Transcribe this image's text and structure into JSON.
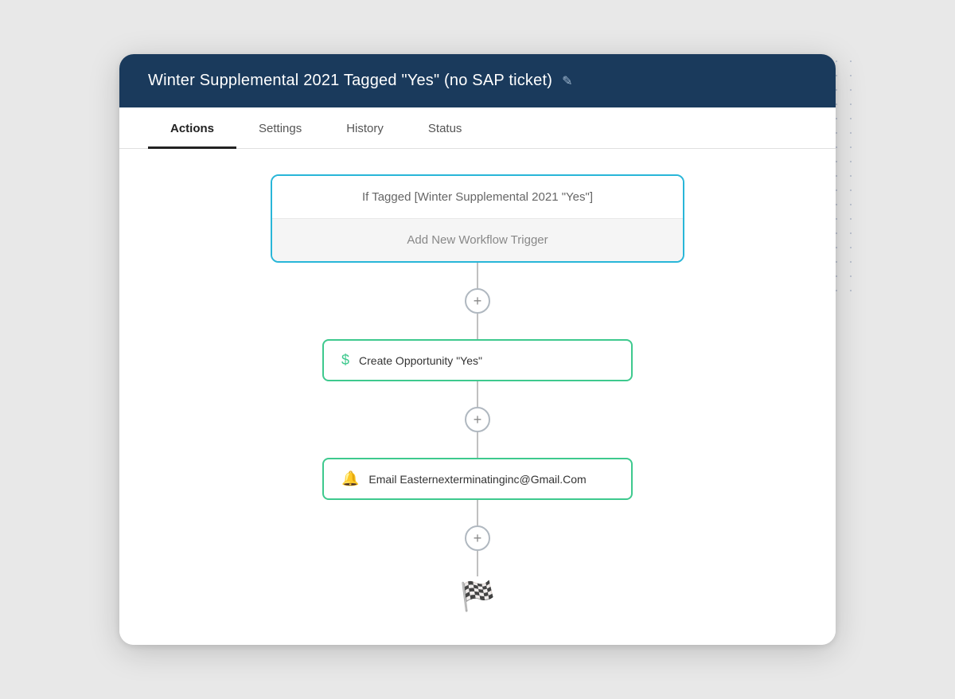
{
  "header": {
    "title": "Winter Supplemental 2021 Tagged \"Yes\" (no SAP ticket)",
    "edit_icon": "✎"
  },
  "tabs": [
    {
      "id": "actions",
      "label": "Actions",
      "active": true
    },
    {
      "id": "settings",
      "label": "Settings",
      "active": false
    },
    {
      "id": "history",
      "label": "History",
      "active": false
    },
    {
      "id": "status",
      "label": "Status",
      "active": false
    }
  ],
  "workflow": {
    "trigger": {
      "condition_text": "If Tagged [Winter Supplemental 2021 \"Yes\"]",
      "add_trigger_label": "Add New Workflow Trigger"
    },
    "actions": [
      {
        "id": "action-1",
        "icon": "$",
        "icon_type": "dollar",
        "label": "Create Opportunity \"Yes\""
      },
      {
        "id": "action-2",
        "icon": "🔔",
        "icon_type": "bell",
        "label": "Email Easternexterminatinginc@Gmail.Com"
      }
    ],
    "finish_icon": "🏁"
  }
}
